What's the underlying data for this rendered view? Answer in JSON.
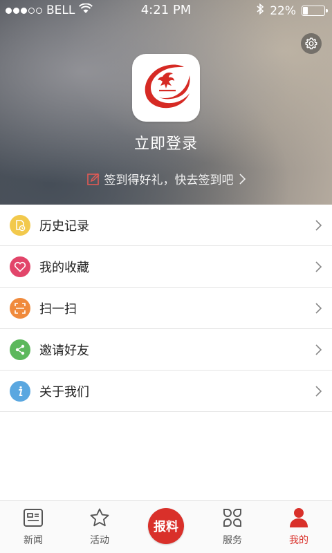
{
  "status_bar": {
    "carrier": "BELL",
    "time": "4:21 PM",
    "battery_text": "22%",
    "battery_level": 0.22
  },
  "header": {
    "login_label": "立即登录",
    "checkin_text": "签到得好礼，快去签到吧"
  },
  "menu": [
    {
      "label": "历史记录",
      "icon": "history-icon",
      "color": "#f2c94c"
    },
    {
      "label": "我的收藏",
      "icon": "heart-icon",
      "color": "#e2456a"
    },
    {
      "label": "扫一扫",
      "icon": "scan-icon",
      "color": "#f08a3c"
    },
    {
      "label": "邀请好友",
      "icon": "share-icon",
      "color": "#5cb85c"
    },
    {
      "label": "关于我们",
      "icon": "info-icon",
      "color": "#5aa7e0"
    }
  ],
  "tabs": [
    {
      "label": "新闻",
      "icon": "news-icon"
    },
    {
      "label": "活动",
      "icon": "star-icon"
    },
    {
      "label": "报料",
      "icon": "report-icon"
    },
    {
      "label": "服务",
      "icon": "grid-icon"
    },
    {
      "label": "我的",
      "icon": "user-icon",
      "active": true
    }
  ],
  "colors": {
    "accent": "#d9302a"
  }
}
